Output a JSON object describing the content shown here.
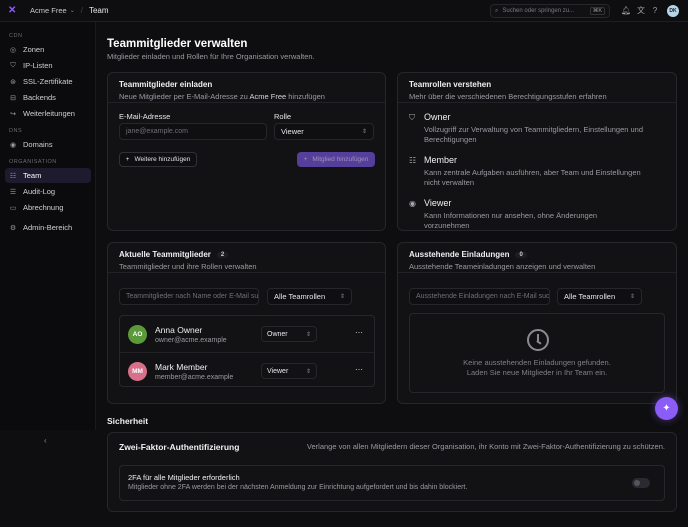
{
  "topbar": {
    "org_name": "Acme Free",
    "crumb": "Team",
    "search_placeholder": "Suchen oder springen zu...",
    "shortcut": "⌘K",
    "avatar_initials": "DK"
  },
  "sidebar": {
    "sections": [
      {
        "label": "CDN",
        "items": [
          "Zonen",
          "IP-Listen",
          "SSL-Zertifikate",
          "Backends",
          "Weiterleitungen"
        ]
      },
      {
        "label": "DNS",
        "items": [
          "Domains"
        ]
      },
      {
        "label": "ORGANISATION",
        "items": [
          "Team",
          "Audit-Log",
          "Abrechnung"
        ]
      }
    ],
    "admin": "Admin-Bereich",
    "active": "Team"
  },
  "page": {
    "title": "Teammitglieder verwalten",
    "subtitle": "Mitglieder einladen und Rollen für Ihre Organisation verwalten."
  },
  "invite": {
    "title": "Teammitglieder einladen",
    "subtitle_prefix": "Neue Mitglieder per E-Mail-Adresse zu",
    "org": "Acme Free",
    "subtitle_suffix": "hinzufügen",
    "email_label": "E-Mail-Adresse",
    "email_placeholder": "jane@example.com",
    "role_label": "Rolle",
    "role_value": "Viewer",
    "add_more": "Weitere hinzufügen",
    "add_member": "Mitglied hinzufügen"
  },
  "roles": {
    "title": "Teamrollen verstehen",
    "subtitle": "Mehr über die verschiedenen Berechtigungsstufen erfahren",
    "items": [
      {
        "name": "Owner",
        "desc": "Vollzugriff zur Verwaltung von Teammitgliedern, Einstellungen und Berechtigungen"
      },
      {
        "name": "Member",
        "desc": "Kann zentrale Aufgaben ausführen, aber Team und Einstellungen nicht verwalten"
      },
      {
        "name": "Viewer",
        "desc": "Kann Informationen nur ansehen, ohne Änderungen vorzunehmen"
      }
    ]
  },
  "current": {
    "title": "Aktuelle Teammitglieder",
    "count": "2",
    "subtitle": "Teammitglieder und ihre Rollen verwalten",
    "search_placeholder": "Teammitglieder nach Name oder E-Mail suchen",
    "filter": "Alle Teamrollen",
    "members": [
      {
        "initials": "AO",
        "name": "Anna Owner",
        "email": "owner@acme.example",
        "role": "Owner",
        "color": "#5a9a3a"
      },
      {
        "initials": "MM",
        "name": "Mark Member",
        "email": "member@acme.example",
        "role": "Viewer",
        "color": "#d9708a"
      }
    ]
  },
  "pending": {
    "title": "Ausstehende Einladungen",
    "count": "0",
    "subtitle": "Ausstehende Teameinladungen anzeigen und verwalten",
    "search_placeholder": "Ausstehende Einladungen nach E-Mail suchen",
    "filter": "Alle Teamrollen",
    "empty_line1": "Keine ausstehenden Einladungen gefunden.",
    "empty_line2": "Laden Sie neue Mitglieder in Ihr Team ein."
  },
  "security": {
    "section": "Sicherheit",
    "title": "Zwei-Faktor-Authentifizierung",
    "description": "Verlange von allen Mitgliedern dieser Organisation, ihr Konto mit Zwei-Faktor-Authentifizierung zu schützen.",
    "option_title": "2FA für alle Mitglieder erforderlich",
    "option_desc": "Mitglieder ohne 2FA werden bei der nächsten Anmeldung zur Einrichtung aufgefordert und bis dahin blockiert.",
    "enabled": false
  },
  "colors": {
    "accent": "#8b5cf6",
    "background": "#0e0e10",
    "card": "#121215"
  }
}
